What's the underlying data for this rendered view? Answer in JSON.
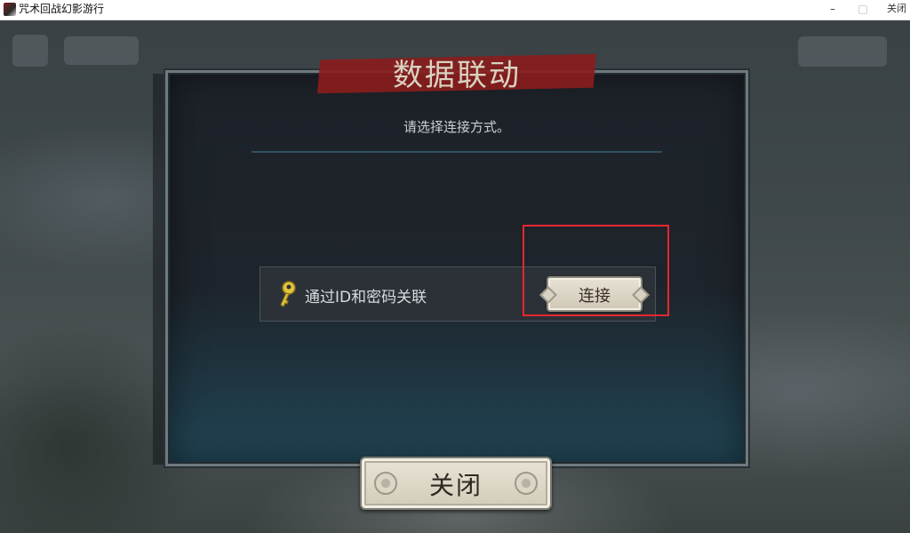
{
  "window": {
    "title": "咒术回战幻影游行",
    "minimize_glyph": "–",
    "maximize_glyph": "□",
    "close_label": "关闭"
  },
  "dialog": {
    "title": "数据联动",
    "subtitle": "请选择连接方式。",
    "option": {
      "icon": "key-icon",
      "label": "通过ID和密码关联",
      "button_label": "连接"
    }
  },
  "footer": {
    "close_label": "关闭"
  },
  "colors": {
    "highlight": "#e8262e",
    "title_banner": "#8b1d1d",
    "button_face": "#e3ddcf"
  }
}
